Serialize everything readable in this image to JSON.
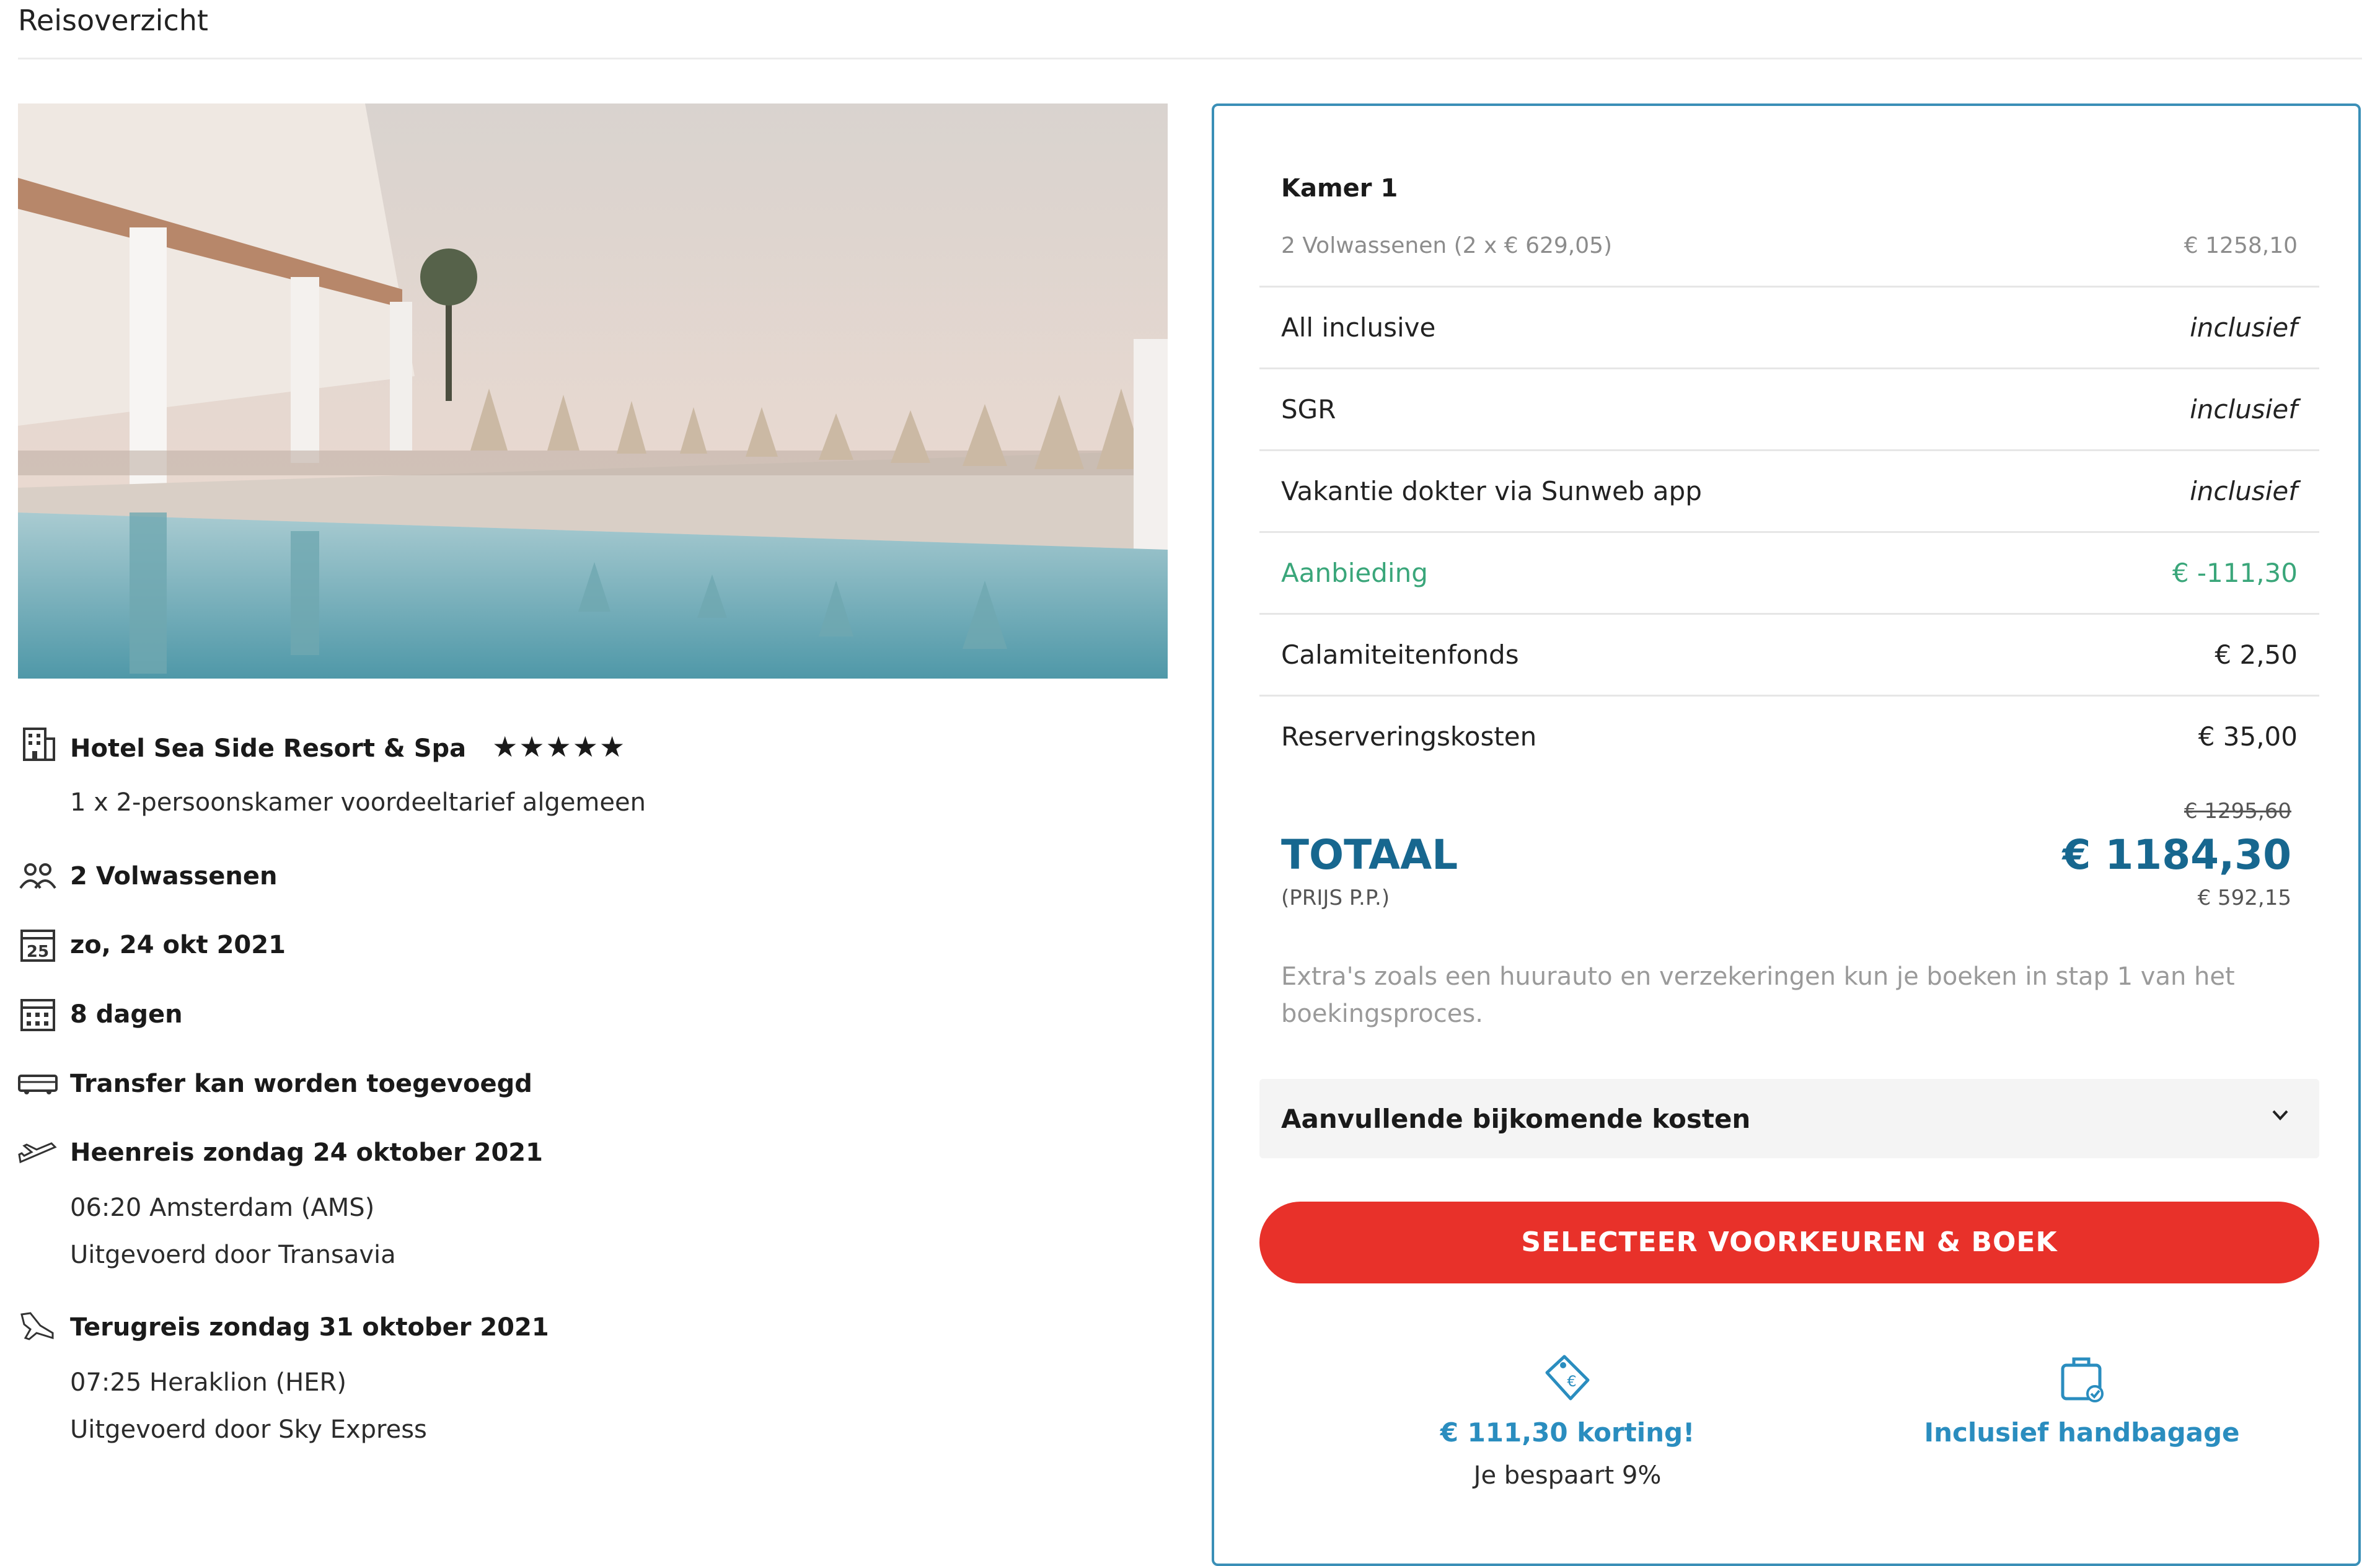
{
  "page": {
    "title": "Reisoverzicht"
  },
  "hotel": {
    "name": "Hotel Sea Side Resort & Spa",
    "stars": "★★★★★",
    "room": "1 x 2-persoonskamer voordeeltarief algemeen"
  },
  "trip": {
    "travellers": "2 Volwassenen",
    "date": "zo, 24 okt 2021",
    "calendar_day": "25",
    "duration": "8 dagen",
    "transfer": "Transfer kan worden toegevoegd",
    "outbound": {
      "title": "Heenreis zondag 24 oktober 2021",
      "departure": "06:20 Amsterdam (AMS)",
      "carrier": "Uitgevoerd door Transavia"
    },
    "return": {
      "title": "Terugreis zondag 31 oktober 2021",
      "departure": "07:25 Heraklion (HER)",
      "carrier": "Uitgevoerd door Sky Express"
    }
  },
  "summary": {
    "room_title": "Kamer 1",
    "adults_label": "2 Volwassenen (2 x € 629,05)",
    "adults_value": "€ 1258,10",
    "rows": [
      {
        "label": "All inclusive",
        "value": "inclusief"
      },
      {
        "label": "SGR",
        "value": "inclusief"
      },
      {
        "label": "Vakantie dokter via Sunweb app",
        "value": "inclusief"
      },
      {
        "label": "Aanbieding",
        "value": "€ -111,30"
      },
      {
        "label": "Calamiteitenfonds",
        "value": "€ 2,50"
      },
      {
        "label": "Reserveringskosten",
        "value": "€ 35,00"
      }
    ],
    "total_old": "€ 1295,60",
    "total_label": "TOTAAL",
    "total_value": "€ 1184,30",
    "pp_label": "(PRIJS P.P.)",
    "pp_value": "€ 592,15",
    "extras_note": "Extra's zoals een huurauto en verzekeringen kun je boeken in stap 1 van het boekingsproces.",
    "accordion_label": "Aanvullende bijkomende kosten",
    "cta_label": "SELECTEER VOORKEUREN & BOEK",
    "usp_discount_title": "€ 111,30 korting!",
    "usp_discount_sub": "Je bespaart 9%",
    "usp_baggage_title": "Inclusief handbagage"
  },
  "colors": {
    "accent_blue": "#17678f",
    "link_blue": "#2a8dbf",
    "card_border": "#3a8fb7",
    "offer_green": "#3aa67a",
    "cta_red": "#e8312a"
  },
  "icons": [
    "hotel-icon",
    "people-icon",
    "calendar-date-icon",
    "calendar-icon",
    "bus-icon",
    "plane-depart-icon",
    "plane-land-icon",
    "chevron-down-icon",
    "price-tag-icon",
    "suitcase-icon"
  ]
}
